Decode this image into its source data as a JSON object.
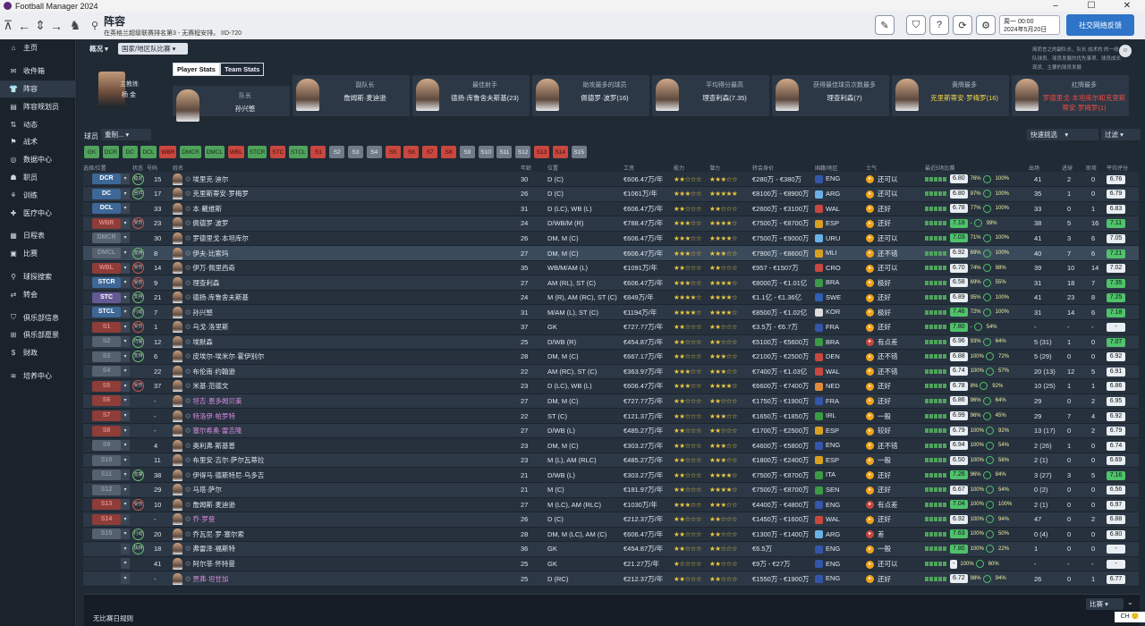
{
  "window": {
    "app_title": "Football Manager 2024"
  },
  "header": {
    "title": "阵容",
    "subtitle": "在英格兰超级联赛排名第3 - 无赛程安排。 IID-720",
    "date_day": "周一 00:00",
    "date": "2024年5月20日",
    "continue_label": "社交网络反馈"
  },
  "sidebar": {
    "items": [
      {
        "label": "主页",
        "icon": "home-icon"
      },
      {
        "label": "收件箱",
        "icon": "inbox-icon"
      },
      {
        "label": "阵容",
        "icon": "shirt-icon"
      },
      {
        "label": "阵容规划员",
        "icon": "planner-icon"
      },
      {
        "label": "动态",
        "icon": "dynamics-icon"
      },
      {
        "label": "战术",
        "icon": "tactics-icon"
      },
      {
        "label": "数据中心",
        "icon": "data-icon"
      },
      {
        "label": "职员",
        "icon": "staff-icon"
      },
      {
        "label": "训练",
        "icon": "training-icon"
      },
      {
        "label": "医疗中心",
        "icon": "medical-icon"
      },
      {
        "label": "日程表",
        "icon": "calendar-icon"
      },
      {
        "label": "比赛",
        "icon": "match-icon"
      },
      {
        "label": "球探搜索",
        "icon": "scouting-icon"
      },
      {
        "label": "转会",
        "icon": "transfer-icon"
      },
      {
        "label": "俱乐部信息",
        "icon": "club-icon"
      },
      {
        "label": "俱乐部愿景",
        "icon": "vision-icon"
      },
      {
        "label": "财政",
        "icon": "finance-icon"
      },
      {
        "label": "培养中心",
        "icon": "development-icon"
      }
    ]
  },
  "top_controls": {
    "overview_label": "概况",
    "squad_select": "国家/地区队比赛",
    "message": "简而言之的副队长、队长 战术的 的一线队球员、球员发展的优先事项、球员成长现状、主要的球员发展",
    "manager_role": "主教练",
    "manager_name": "杨 金",
    "players_label": "球员",
    "view_label": "重制...",
    "quick_pick_label": "快速挑选",
    "filter_label": "过滤",
    "bottom_text": "无比赛日规则",
    "match_label": "比赛",
    "ime": "CH 🙂"
  },
  "stat_tabs": [
    "Player Stats",
    "Team Stats"
  ],
  "cards": [
    {
      "label": "队长",
      "name": "孙兴慜"
    },
    {
      "label": "副队长",
      "name": "詹姆斯·麦迪逊"
    },
    {
      "label": "最佳射手",
      "name": "德扬·库鲁舍夫斯基(23)"
    },
    {
      "label": "助攻最多的球员",
      "name": "佩德罗·波罗(16)"
    },
    {
      "label": "平均得分最高",
      "name": "理查利森(7.35)"
    },
    {
      "label": "获得最佳球员次数最多",
      "name": "理查利森(7)"
    },
    {
      "label": "黄牌最多",
      "name": "克里斯蒂安·罗梅罗(16)"
    },
    {
      "label": "红牌最多",
      "name": "罗德里戈·本坦库尔和克里斯蒂安·罗梅罗(1)"
    }
  ],
  "filter_buttons": [
    {
      "label": "GK",
      "c": "green"
    },
    {
      "label": "DCR",
      "c": "green"
    },
    {
      "label": "DC",
      "c": "green"
    },
    {
      "label": "DCL",
      "c": "green"
    },
    {
      "label": "WBR",
      "c": "red"
    },
    {
      "label": "DMCR",
      "c": "green"
    },
    {
      "label": "DMCL",
      "c": "green"
    },
    {
      "label": "WBL",
      "c": "red"
    },
    {
      "label": "STCR",
      "c": "green"
    },
    {
      "label": "STC",
      "c": "red"
    },
    {
      "label": "STCL",
      "c": "green"
    },
    {
      "label": "S1",
      "c": "red"
    },
    {
      "label": "S2",
      "c": "grey"
    },
    {
      "label": "S3",
      "c": "grey"
    },
    {
      "label": "S4",
      "c": "grey"
    },
    {
      "label": "S5",
      "c": "red"
    },
    {
      "label": "S6",
      "c": "red"
    },
    {
      "label": "S7",
      "c": "red"
    },
    {
      "label": "S8",
      "c": "red"
    },
    {
      "label": "S9",
      "c": "grey"
    },
    {
      "label": "S10",
      "c": "grey"
    },
    {
      "label": "S11",
      "c": "grey"
    },
    {
      "label": "S12",
      "c": "grey"
    },
    {
      "label": "S13",
      "c": "red"
    },
    {
      "label": "S14",
      "c": "red"
    },
    {
      "label": "S15",
      "c": "grey"
    }
  ],
  "columns": [
    "选择/位置",
    "状态",
    "号码",
    "姓名",
    "年龄",
    "位置",
    "工资",
    "能力",
    "潜力",
    "转会身价",
    "国籍/地区",
    "士气",
    "最近5场比赛",
    "出场",
    "进球",
    "助攻",
    "平均评分"
  ],
  "players": [
    {
      "pos": "DCR",
      "pc": "blue",
      "role": "稳定",
      "num": "15",
      "name": "埃里克·迪尔",
      "age": "30",
      "position": "D (C)",
      "wage": "€606.47万/年",
      "ab": "★★☆☆☆",
      "po": "★★★☆☆",
      "value": "€280万 - €380万",
      "flag": "#3355aa",
      "nat": "ENG",
      "morale": "还可以",
      "form": "6.80",
      "pct": "76%",
      "pct2": "100%",
      "apps": "41",
      "gls": "2",
      "ast": "0",
      "avg": "6.76",
      "avgc": "w"
    },
    {
      "pos": "DC",
      "pc": "blue",
      "role": "回归",
      "num": "17",
      "name": "克里斯蒂安·罗梅罗",
      "age": "26",
      "position": "D (C)",
      "wage": "€1061万/年",
      "ab": "★★★☆☆",
      "po": "★★★★★",
      "value": "€8100万 - €8900万",
      "flag": "#6ab0e6",
      "nat": "ARG",
      "morale": "还可以",
      "form": "6.80",
      "pct": "97%",
      "pct2": "100%",
      "apps": "35",
      "gls": "1",
      "ast": "0",
      "avg": "6.79",
      "avgc": "w"
    },
    {
      "pos": "DCL",
      "pc": "blue",
      "role": "",
      "num": "33",
      "name": "本·戴维斯",
      "age": "31",
      "position": "D (LC), WB (L)",
      "wage": "€606.47万/年",
      "ab": "★★☆☆☆",
      "po": "★★☆☆☆",
      "value": "€2600万 - €3100万",
      "flag": "#c8473f",
      "nat": "WAL",
      "morale": "还好",
      "form": "6.78",
      "pct": "77%",
      "pct2": "100%",
      "apps": "33",
      "gls": "0",
      "ast": "1",
      "avg": "6.83",
      "avgc": "w"
    },
    {
      "pos": "WBR",
      "pc": "red",
      "role": "受伤",
      "num": "23",
      "name": "佩德罗·波罗",
      "age": "24",
      "position": "D/WB/M (R)",
      "wage": "€788.47万/年",
      "ab": "★★★☆☆",
      "po": "★★★★☆",
      "value": "€7500万 - €8700万",
      "flag": "#d9a020",
      "nat": "ESP",
      "morale": "还好",
      "form": "7.18",
      "pct": "-",
      "pct2": "99%",
      "apps": "38",
      "gls": "5",
      "ast": "16",
      "avg": "7.11",
      "avgc": "g"
    },
    {
      "pos": "DMCR",
      "pc": "grey",
      "role": "",
      "num": "30",
      "name": "罗德里戈·本坦库尔",
      "age": "26",
      "position": "DM, M (C)",
      "wage": "€606.47万/年",
      "ab": "★★★☆☆",
      "po": "★★★★☆",
      "value": "€7500万 - €9000万",
      "flag": "#6ab0e6",
      "nat": "URU",
      "morale": "还可以",
      "form": "7.03",
      "pct": "71%",
      "pct2": "100%",
      "apps": "41",
      "gls": "3",
      "ast": "6",
      "avg": "7.05",
      "avgc": "w"
    },
    {
      "pos": "DMCL",
      "pc": "grey",
      "role": "支持",
      "num": "8",
      "name": "伊夫·比索玛",
      "age": "27",
      "position": "DM, M (C)",
      "wage": "€606.47万/年",
      "ab": "★★★☆☆",
      "po": "★★★☆☆",
      "value": "€7900万 - €8600万",
      "flag": "#d9a020",
      "nat": "MLI",
      "morale": "还不错",
      "form": "6.92",
      "pct": "69%",
      "pct2": "100%",
      "apps": "40",
      "gls": "7",
      "ast": "6",
      "avg": "7.21",
      "avgc": "g"
    },
    {
      "pos": "WBL",
      "pc": "red",
      "role": "受伤",
      "num": "14",
      "name": "伊万·佩里西奇",
      "age": "35",
      "position": "WB/M/AM (L)",
      "wage": "€1091万/年",
      "ab": "★★☆☆☆",
      "po": "★★☆☆☆",
      "value": "€957 - €1507万",
      "flag": "#c8473f",
      "nat": "CRO",
      "morale": "还可以",
      "form": "6.70",
      "pct": "74%",
      "pct2": "98%",
      "apps": "39",
      "gls": "10",
      "ast": "14",
      "avg": "7.02",
      "avgc": "w"
    },
    {
      "pos": "STCR",
      "pc": "blue",
      "role": "受伤",
      "num": "9",
      "name": "理查利森",
      "age": "27",
      "position": "AM (RL), ST (C)",
      "wage": "€606.47万/年",
      "ab": "★★★☆☆",
      "po": "★★★★☆",
      "value": "€8000万 - €1.01亿",
      "flag": "#3b9a45",
      "nat": "BRA",
      "morale": "极好",
      "form": "6.58",
      "pct": "69%",
      "pct2": "55%",
      "apps": "31",
      "gls": "18",
      "ast": "7",
      "avg": "7.35",
      "avgc": "g"
    },
    {
      "pos": "STC",
      "pc": "purple",
      "role": "支持",
      "num": "21",
      "name": "德扬·库鲁舍夫斯基",
      "age": "24",
      "position": "M (R), AM (RC), ST (C)",
      "wage": "€849万/年",
      "ab": "★★★★☆",
      "po": "★★★★☆",
      "value": "€1.1亿 - €1.36亿",
      "flag": "#3060b0",
      "nat": "SWE",
      "morale": "还好",
      "form": "6.89",
      "pct": "95%",
      "pct2": "100%",
      "apps": "41",
      "gls": "23",
      "ast": "8",
      "avg": "7.25",
      "avgc": "g"
    },
    {
      "pos": "STCL",
      "pc": "blue",
      "role": "行动",
      "num": "7",
      "name": "孙兴慜",
      "age": "31",
      "position": "M/AM (L), ST (C)",
      "wage": "€1194万/年",
      "ab": "★★★★☆",
      "po": "★★★★☆",
      "value": "€8500万 - €1.02亿",
      "flag": "#dddddd",
      "nat": "KOR",
      "morale": "极好",
      "form": "7.46",
      "pct": "72%",
      "pct2": "100%",
      "apps": "31",
      "gls": "14",
      "ast": "6",
      "avg": "7.18",
      "avgc": "g"
    },
    {
      "pos": "S1",
      "pc": "red",
      "role": "受伤",
      "num": "1",
      "name": "乌戈·洛里斯",
      "age": "37",
      "position": "GK",
      "wage": "€727.77万/年",
      "ab": "★★☆☆☆",
      "po": "★★☆☆☆",
      "value": "€3.5万 - €6.7万",
      "flag": "#3355aa",
      "nat": "FRA",
      "morale": "还好",
      "form": "7.80",
      "pct": "-",
      "pct2": "54%",
      "apps": "-",
      "gls": "-",
      "ast": "-",
      "avg": "-",
      "avgc": "w"
    },
    {
      "pos": "S2",
      "pc": "grey",
      "role": "巧偷",
      "num": "12",
      "name": "埃默森",
      "age": "25",
      "position": "D/WB (R)",
      "wage": "€454.87万/年",
      "ab": "★★☆☆☆",
      "po": "★★☆☆☆",
      "value": "€5100万 - €5600万",
      "flag": "#3b9a45",
      "nat": "BRA",
      "morale": "有点差",
      "form": "6.96",
      "pct": "93%",
      "pct2": "64%",
      "apps": "5 (31)",
      "gls": "1",
      "ast": "0",
      "avg": "7.07",
      "avgc": "g"
    },
    {
      "pos": "S3",
      "pc": "grey",
      "role": "支持",
      "num": "6",
      "name": "皮埃尔-埃米尔·霍伊别尔",
      "age": "28",
      "position": "DM, M (C)",
      "wage": "€667.17万/年",
      "ab": "★★☆☆☆",
      "po": "★★★☆☆",
      "value": "€2100万 - €2500万",
      "flag": "#c8473f",
      "nat": "DEN",
      "morale": "还不错",
      "form": "6.88",
      "pct": "100%",
      "pct2": "72%",
      "apps": "5 (29)",
      "gls": "0",
      "ast": "0",
      "avg": "6.92",
      "avgc": "w"
    },
    {
      "pos": "S4",
      "pc": "grey",
      "role": "",
      "num": "22",
      "name": "布伦南·约翰逊",
      "age": "22",
      "position": "AM (RC), ST (C)",
      "wage": "€363.97万/年",
      "ab": "★★★☆☆",
      "po": "★★★☆☆",
      "value": "€7400万 - €1.03亿",
      "flag": "#c8473f",
      "nat": "WAL",
      "morale": "还不错",
      "form": "6.74",
      "pct": "100%",
      "pct2": "57%",
      "apps": "20 (13)",
      "gls": "12",
      "ast": "5",
      "avg": "6.91",
      "avgc": "w"
    },
    {
      "pos": "S5",
      "pc": "red",
      "role": "受伤",
      "num": "37",
      "name": "米基·范德文",
      "age": "23",
      "position": "D (LC), WB (L)",
      "wage": "€606.47万/年",
      "ab": "★★★☆☆",
      "po": "★★★★☆",
      "value": "€6600万 - €7400万",
      "flag": "#e08a3a",
      "nat": "NED",
      "morale": "还好",
      "form": "6.78",
      "pct": "8%",
      "pct2": "92%",
      "apps": "10 (25)",
      "gls": "1",
      "ast": "1",
      "avg": "6.86",
      "avgc": "w"
    },
    {
      "pos": "S6",
      "pc": "red",
      "role": "",
      "num": "-",
      "name": "坦吉·恩多姆贝莱",
      "age": "27",
      "position": "DM, M (C)",
      "wage": "€727.77万/年",
      "ab": "★★☆☆☆",
      "po": "★★☆☆☆",
      "value": "€1750万 - €1900万",
      "flag": "#3355aa",
      "nat": "FRA",
      "morale": "还好",
      "form": "6.86",
      "pct": "96%",
      "pct2": "64%",
      "apps": "29",
      "gls": "0",
      "ast": "2",
      "avg": "6.95",
      "avgc": "w"
    },
    {
      "pos": "S7",
      "pc": "red",
      "role": "",
      "num": "-",
      "name": "特洛伊·帕罗特",
      "age": "22",
      "position": "ST (C)",
      "wage": "€121.37万/年",
      "ab": "★★☆☆☆",
      "po": "★★★☆☆",
      "value": "€1650万 - €1850万",
      "flag": "#3b9a45",
      "nat": "IRL",
      "morale": "一般",
      "form": "6.99",
      "pct": "96%",
      "pct2": "45%",
      "apps": "29",
      "gls": "7",
      "ast": "4",
      "avg": "6.92",
      "avgc": "w"
    },
    {
      "pos": "S8",
      "pc": "red",
      "role": "",
      "num": "-",
      "name": "塞尔希奥·雷吉隆",
      "age": "27",
      "position": "D/WB (L)",
      "wage": "€485.27万/年",
      "ab": "★★☆☆☆",
      "po": "★★☆☆☆",
      "value": "€1700万 - €2500万",
      "flag": "#d9a020",
      "nat": "ESP",
      "morale": "较好",
      "form": "6.79",
      "pct": "100%",
      "pct2": "92%",
      "apps": "13 (17)",
      "gls": "0",
      "ast": "2",
      "avg": "6.79",
      "avgc": "w"
    },
    {
      "pos": "S9",
      "pc": "grey",
      "role": "",
      "num": "4",
      "name": "奥利弗·斯基普",
      "age": "23",
      "position": "DM, M (C)",
      "wage": "€303.27万/年",
      "ab": "★★☆☆☆",
      "po": "★★★☆☆",
      "value": "€4600万 - €5800万",
      "flag": "#3355aa",
      "nat": "ENG",
      "morale": "还不错",
      "form": "6.94",
      "pct": "100%",
      "pct2": "54%",
      "apps": "2 (26)",
      "gls": "1",
      "ast": "0",
      "avg": "6.74",
      "avgc": "w"
    },
    {
      "pos": "S10",
      "pc": "grey",
      "role": "",
      "num": "11",
      "name": "布里安·吉尔·萨尔瓦蒂拉",
      "age": "23",
      "position": "M (L), AM (RLC)",
      "wage": "€485.27万/年",
      "ab": "★★☆☆☆",
      "po": "★★★☆☆",
      "value": "€1800万 - €2400万",
      "flag": "#d9a020",
      "nat": "ESP",
      "morale": "一般",
      "form": "6.50",
      "pct": "100%",
      "pct2": "56%",
      "apps": "2 (1)",
      "gls": "0",
      "ast": "0",
      "avg": "6.69",
      "avgc": "w"
    },
    {
      "pos": "S11",
      "pc": "grey",
      "role": "支撑",
      "num": "38",
      "name": "伊得马·德斯特尼·乌多吉",
      "age": "21",
      "position": "D/WB (L)",
      "wage": "€303.27万/年",
      "ab": "★★☆☆☆",
      "po": "★★★★☆",
      "value": "€7500万 - €8700万",
      "flag": "#3b9a45",
      "nat": "ITA",
      "morale": "还好",
      "form": "7.26",
      "pct": "96%",
      "pct2": "84%",
      "apps": "3 (27)",
      "gls": "3",
      "ast": "5",
      "avg": "7.16",
      "avgc": "g"
    },
    {
      "pos": "S12",
      "pc": "grey",
      "role": "",
      "num": "29",
      "name": "马塔·萨尔",
      "age": "21",
      "position": "M (C)",
      "wage": "€181.97万/年",
      "ab": "★★☆☆☆",
      "po": "★★★★☆",
      "value": "€7500万 - €8700万",
      "flag": "#3b9a45",
      "nat": "SEN",
      "morale": "还好",
      "form": "6.67",
      "pct": "100%",
      "pct2": "54%",
      "apps": "0 (2)",
      "gls": "0",
      "ast": "0",
      "avg": "6.56",
      "avgc": "w"
    },
    {
      "pos": "S13",
      "pc": "red",
      "role": "受伤",
      "num": "10",
      "name": "詹姆斯·麦迪逊",
      "age": "27",
      "position": "M (LC), AM (RLC)",
      "wage": "€1030万/年",
      "ab": "★★★☆☆",
      "po": "★★★☆☆",
      "value": "€4400万 - €4800万",
      "flag": "#3355aa",
      "nat": "ENG",
      "morale": "有点差",
      "form": "7.04",
      "pct": "100%",
      "pct2": "100%",
      "apps": "2 (1)",
      "gls": "0",
      "ast": "0",
      "avg": "6.97",
      "avgc": "w"
    },
    {
      "pos": "S14",
      "pc": "red",
      "role": "",
      "num": "-",
      "name": "乔·罗登",
      "age": "26",
      "position": "D (C)",
      "wage": "€212.37万/年",
      "ab": "★★☆☆☆",
      "po": "★★☆☆☆",
      "value": "€1450万 - €1600万",
      "flag": "#c8473f",
      "nat": "WAL",
      "morale": "还好",
      "form": "6.92",
      "pct": "100%",
      "pct2": "94%",
      "apps": "47",
      "gls": "0",
      "ast": "2",
      "avg": "6.88",
      "avgc": "w"
    },
    {
      "pos": "S15",
      "pc": "grey",
      "role": "行动",
      "num": "20",
      "name": "乔瓦尼·罗·塞尔索",
      "age": "28",
      "position": "DM, M (LC), AM (C)",
      "wage": "€606.47万/年",
      "ab": "★★☆☆☆",
      "po": "★★☆☆☆",
      "value": "€1300万 - €1400万",
      "flag": "#6ab0e6",
      "nat": "ARG",
      "morale": "差",
      "form": "7.63",
      "pct": "100%",
      "pct2": "50%",
      "apps": "0 (4)",
      "gls": "0",
      "ast": "0",
      "avg": "6.80",
      "avgc": "w"
    },
    {
      "pos": "",
      "pc": "empty",
      "role": "扶持",
      "num": "18",
      "name": "弗雷泽·福斯特",
      "age": "36",
      "position": "GK",
      "wage": "€454.87万/年",
      "ab": "★★☆☆☆",
      "po": "★★☆☆☆",
      "value": "€6.5万",
      "flag": "#3355aa",
      "nat": "ENG",
      "morale": "一般",
      "form": "7.80",
      "pct": "100%",
      "pct2": "22%",
      "apps": "1",
      "gls": "0",
      "ast": "0",
      "avg": "-",
      "avgc": "w"
    },
    {
      "pos": "",
      "pc": "empty",
      "role": "",
      "num": "41",
      "name": "阿尔菲·怀特曼",
      "age": "25",
      "position": "GK",
      "wage": "€21.27万/年",
      "ab": "★☆☆☆☆",
      "po": "★★☆☆☆",
      "value": "€9万 - €27万",
      "flag": "#3355aa",
      "nat": "ENG",
      "morale": "还可以",
      "form": "-",
      "pct": "100%",
      "pct2": "60%",
      "apps": "-",
      "gls": "-",
      "ast": "-",
      "avg": "-",
      "avgc": "w"
    },
    {
      "pos": "",
      "pc": "empty",
      "role": "",
      "num": "-",
      "name": "贾弗·坦甘加",
      "age": "25",
      "position": "D (RC)",
      "wage": "€212.37万/年",
      "ab": "★★☆☆☆",
      "po": "★★☆☆☆",
      "value": "€1550万 - €1900万",
      "flag": "#3355aa",
      "nat": "ENG",
      "morale": "还好",
      "form": "6.72",
      "pct": "98%",
      "pct2": "94%",
      "apps": "26",
      "gls": "0",
      "ast": "1",
      "avg": "6.77",
      "avgc": "w"
    }
  ],
  "colors": {
    "accent": "#2e74c8",
    "positive": "#4fa35c",
    "negative": "#c8473f",
    "star": "#e9c542"
  }
}
